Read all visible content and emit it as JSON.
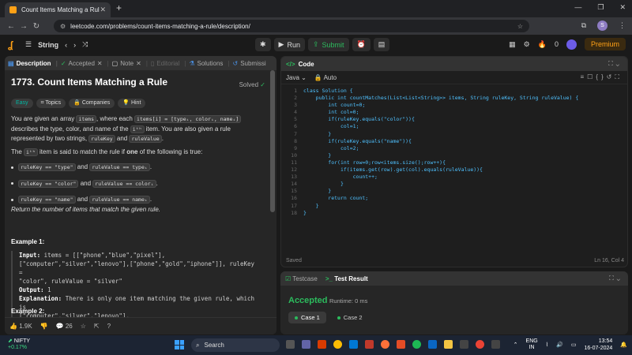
{
  "browser": {
    "tab_title": "Count Items Matching a Rule",
    "tab_close": "✕",
    "new_tab": "+",
    "url": "leetcode.com/problems/count-items-matching-a-rule/description/",
    "profile_initial": "S"
  },
  "lc_bar": {
    "list_name": "String",
    "run_label": "Run",
    "submit_label": "Submit",
    "streak_count": "0",
    "premium_label": "Premium"
  },
  "left_tabs": [
    {
      "label": "Description",
      "icon": "document-icon"
    },
    {
      "label": "Accepted",
      "icon": "check-icon"
    },
    {
      "label": "Note",
      "icon": "note-icon"
    },
    {
      "label": "Editorial",
      "icon": "book-icon"
    },
    {
      "label": "Solutions",
      "icon": "flask-icon"
    },
    {
      "label": "Submissi",
      "icon": "history-icon"
    }
  ],
  "problem": {
    "title": "1773. Count Items Matching a Rule",
    "status": "Solved",
    "difficulty": "Easy",
    "tags": [
      "Topics",
      "Companies",
      "Hint"
    ],
    "p1_a": "You are given an array ",
    "p1_code1": "items",
    "p1_b": ", where each ",
    "p1_code2": "items[i] = [typeᵢ, colorᵢ, nameᵢ]",
    "p1_c": " describes the type, color, and name of the ",
    "p1_code3": "iᵗʰ",
    "p1_d": " item. You are also given a rule represented by two strings, ",
    "p1_code4": "ruleKey",
    "p1_e": " and ",
    "p1_code5": "ruleValue",
    "p1_f": ".",
    "p2_a": "The ",
    "p2_code": "iᵗʰ",
    "p2_b": " item is said to match the rule if ",
    "p2_bold": "one",
    "p2_c": " of the following is true:",
    "bullets": [
      {
        "c1": "ruleKey == \"type\"",
        "and": "and",
        "c2": "ruleValue == typeᵢ",
        "end": "."
      },
      {
        "c1": "ruleKey == \"color\"",
        "and": "and",
        "c2": "ruleValue == colorᵢ",
        "end": "."
      },
      {
        "c1": "ruleKey == \"name\"",
        "and": "and",
        "c2": "ruleValue == nameᵢ",
        "end": "."
      }
    ],
    "return_text": "Return the number of items that match the given rule.",
    "example1_heading": "Example 1:",
    "ex_input_label": "Input:",
    "ex_input_l1": " items = [[\"phone\",\"blue\",\"pixel\"],",
    "ex_input_l2": "[\"computer\",\"silver\",\"lenovo\"],[\"phone\",\"gold\",\"iphone\"]], ruleKey =",
    "ex_input_l3": "\"color\", ruleValue = \"silver\"",
    "ex_output_label": "Output:",
    "ex_output": " 1",
    "ex_expl_label": "Explanation:",
    "ex_expl_l1": " There is only one item matching the given rule, which is",
    "ex_expl_l2": "[\"computer\",\"silver\",\"lenovo\"].",
    "example2_heading": "Example 2:"
  },
  "left_footer": {
    "likes": "1.9K",
    "comments": "26"
  },
  "code_panel": {
    "title": "Code",
    "language": "Java",
    "mode": "Auto",
    "lines": [
      {
        "n": "1",
        "t": "class Solution {"
      },
      {
        "n": "2",
        "t": "    public int countMatches(List<List<String>> items, String ruleKey, String ruleValue) {"
      },
      {
        "n": "3",
        "t": "        int count=0;"
      },
      {
        "n": "4",
        "t": "        int col=0;"
      },
      {
        "n": "5",
        "t": "        if(ruleKey.equals(\"color\")){"
      },
      {
        "n": "6",
        "t": "            col=1;"
      },
      {
        "n": "7",
        "t": "        }"
      },
      {
        "n": "8",
        "t": "        if(ruleKey.equals(\"name\")){"
      },
      {
        "n": "9",
        "t": "            col=2;"
      },
      {
        "n": "10",
        "t": "        }"
      },
      {
        "n": "11",
        "t": "        for(int row=0;row<items.size();row++){"
      },
      {
        "n": "12",
        "t": "            if(items.get(row).get(col).equals(ruleValue)){"
      },
      {
        "n": "13",
        "t": "                count++;"
      },
      {
        "n": "14",
        "t": "            }"
      },
      {
        "n": "15",
        "t": "        }"
      },
      {
        "n": "16",
        "t": "        return count;"
      },
      {
        "n": "17",
        "t": "    }"
      },
      {
        "n": "18",
        "t": "}"
      }
    ],
    "saved_label": "Saved",
    "cursor_pos": "Ln 16, Col 4"
  },
  "result_panel": {
    "tab_testcase": "Testcase",
    "tab_result": "Test Result",
    "verdict": "Accepted",
    "runtime": "Runtime: 0 ms",
    "cases": [
      "Case 1",
      "Case 2"
    ]
  },
  "taskbar": {
    "ticker_name": "NIFTY",
    "ticker_change": "+0.17%",
    "search_label": "Search",
    "lang_top": "ENG",
    "lang_bottom": "IN",
    "time": "13:54",
    "date": "16-07-2024"
  },
  "colors": {
    "accent_orange": "#ffa116",
    "accepted_green": "#2cbb5d",
    "easy_teal": "#00b8a3"
  }
}
